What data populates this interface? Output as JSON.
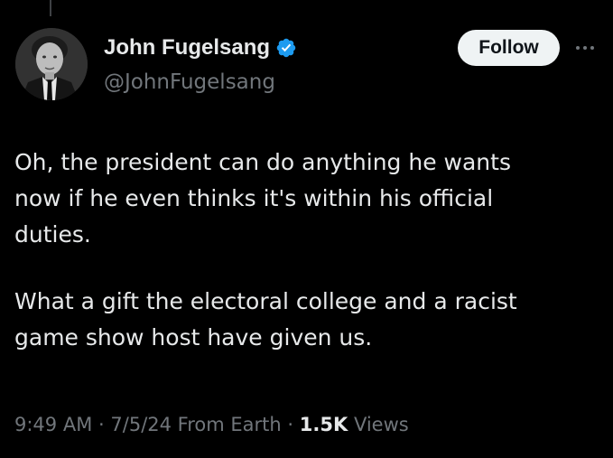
{
  "author": {
    "display_name": "John Fugelsang",
    "handle": "@JohnFugelsang",
    "verified": true,
    "avatar_icon": "profile-photo"
  },
  "actions": {
    "follow_label": "Follow",
    "more_icon": "more-horizontal-icon"
  },
  "tweet": {
    "paragraphs": [
      "Oh, the president can do anything he wants\nnow if he even thinks it's within his official\nduties.",
      "What a gift the electoral college and a racist\ngame show host have given us."
    ]
  },
  "meta": {
    "time": "9:49 AM",
    "separator": "·",
    "date": "7/5/24",
    "source": "From Earth",
    "views_count": "1.5K",
    "views_label": "Views"
  },
  "colors": {
    "background": "#000000",
    "text_primary": "#e7e9ea",
    "text_secondary": "#71767b",
    "verified_blue": "#1d9bf0",
    "follow_bg": "#eff3f4"
  }
}
